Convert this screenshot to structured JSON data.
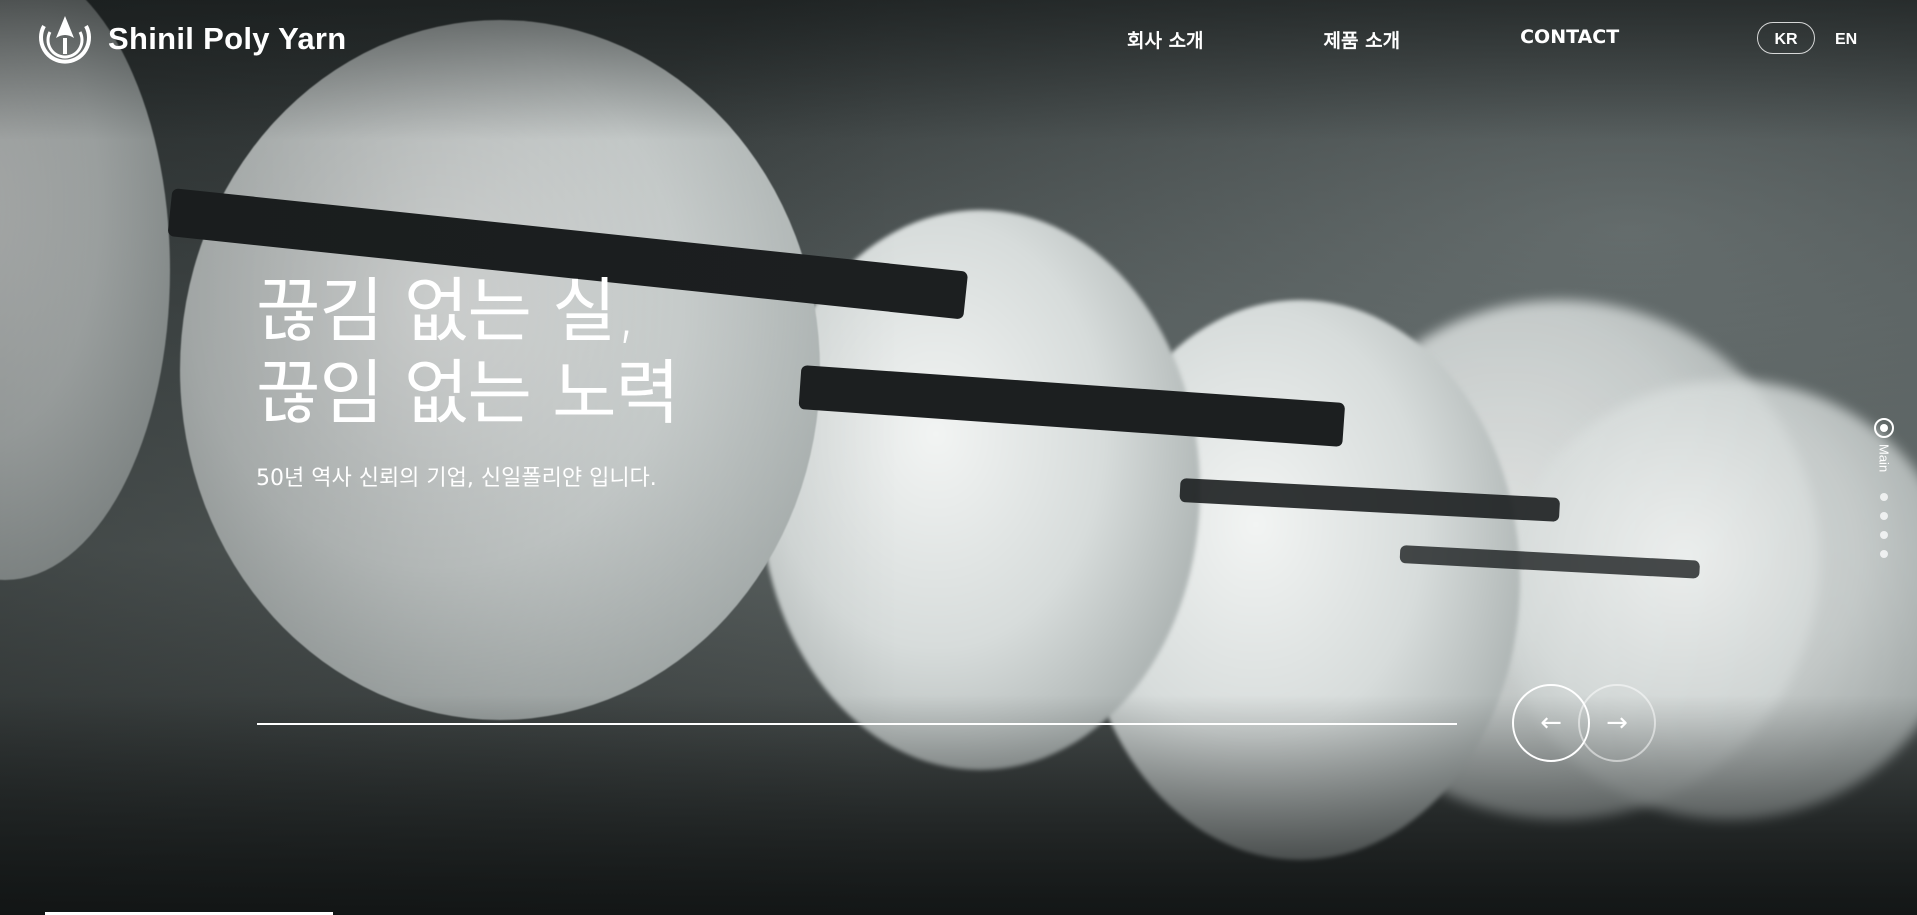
{
  "header": {
    "brand": "Shinil Poly Yarn",
    "nav": [
      {
        "label": "회사 소개"
      },
      {
        "label": "제품 소개"
      },
      {
        "label": "CONTACT"
      }
    ],
    "languages": {
      "active": "KR",
      "other": "EN"
    }
  },
  "hero": {
    "title_line1": "끊김 없는 실,",
    "title_line2": "끊임 없는 노력",
    "subtitle": "50년 역사 신뢰의 기업, 신일폴리얀 입니다."
  },
  "slider": {
    "prev_symbol": "←",
    "next_symbol": "→"
  },
  "pager": {
    "active_label": "Main",
    "total_sections": 5,
    "active_index": 1
  },
  "icons": {
    "logo": "brand-flame-logo-icon",
    "prev": "arrow-left-icon",
    "next": "arrow-right-icon"
  },
  "colors": {
    "text": "#ffffff",
    "background": "#3a3f40"
  }
}
